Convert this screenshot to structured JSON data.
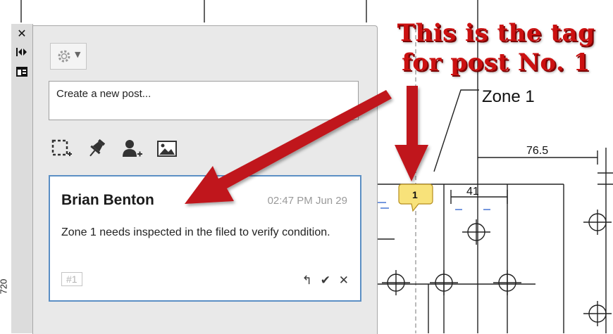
{
  "headline": {
    "line1": "This is the tag",
    "line2": "for post No. 1"
  },
  "drawing": {
    "zone_label": "Zone 1",
    "dims": [
      "76.5",
      "41"
    ],
    "side_label": "720",
    "tag_number": "1"
  },
  "toolbar": {
    "close_glyph": "✕"
  },
  "panel": {
    "settings_icon": "gear-icon",
    "input_placeholder": "Create a new post...",
    "tools": [
      "selection-box-icon",
      "pin-icon",
      "add-user-icon",
      "image-icon"
    ]
  },
  "post": {
    "author": "Brian Benton",
    "time": "02:47 PM Jun 29",
    "body": "Zone 1 needs inspected in the filed to verify condition.",
    "tag": "#1",
    "actions": [
      "reply-icon",
      "check-icon",
      "close-icon"
    ]
  },
  "colors": {
    "arrow": "#c0161b",
    "card_border": "#5b8fc4",
    "tag_bubble": "#f8e27a"
  }
}
